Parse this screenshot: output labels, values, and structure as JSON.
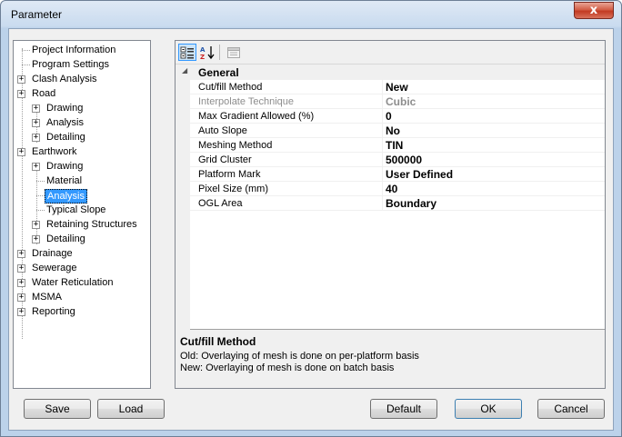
{
  "window": {
    "title": "Parameter",
    "close_label": "x"
  },
  "tree": {
    "items": [
      {
        "label": "Project Information",
        "level": 0,
        "expander": false
      },
      {
        "label": "Program Settings",
        "level": 0,
        "expander": false
      },
      {
        "label": "Clash Analysis",
        "level": 0,
        "expander": true
      },
      {
        "label": "Road",
        "level": 0,
        "expander": true
      },
      {
        "label": "Drawing",
        "level": 1,
        "expander": true
      },
      {
        "label": "Analysis",
        "level": 1,
        "expander": true
      },
      {
        "label": "Detailing",
        "level": 1,
        "expander": true
      },
      {
        "label": "Earthwork",
        "level": 0,
        "expander": true
      },
      {
        "label": "Drawing",
        "level": 1,
        "expander": true
      },
      {
        "label": "Material",
        "level": 1,
        "expander": false
      },
      {
        "label": "Analysis",
        "level": 1,
        "expander": false,
        "selected": true
      },
      {
        "label": "Typical Slope",
        "level": 1,
        "expander": false
      },
      {
        "label": "Retaining Structures",
        "level": 1,
        "expander": true
      },
      {
        "label": "Detailing",
        "level": 1,
        "expander": true
      },
      {
        "label": "Drainage",
        "level": 0,
        "expander": true
      },
      {
        "label": "Sewerage",
        "level": 0,
        "expander": true
      },
      {
        "label": "Water Reticulation",
        "level": 0,
        "expander": true
      },
      {
        "label": "MSMA",
        "level": 0,
        "expander": true
      },
      {
        "label": "Reporting",
        "level": 0,
        "expander": true
      }
    ],
    "expander_symbol": "+"
  },
  "propertygrid": {
    "toolbar": {
      "categorized_icon": "categorized-icon",
      "alphabetical_icon": "sort-alphabetical-icon",
      "property_pages_icon": "property-pages-icon"
    },
    "category": "General",
    "properties": [
      {
        "name": "Cut/fill Method",
        "value": "New",
        "disabled": false
      },
      {
        "name": "Interpolate Technique",
        "value": "Cubic",
        "disabled": true
      },
      {
        "name": "Max Gradient Allowed (%)",
        "value": "0",
        "disabled": false
      },
      {
        "name": "Auto Slope",
        "value": "No",
        "disabled": false
      },
      {
        "name": "Meshing Method",
        "value": "TIN",
        "disabled": false
      },
      {
        "name": "Grid Cluster",
        "value": "500000",
        "disabled": false
      },
      {
        "name": "Platform Mark",
        "value": "User Defined",
        "disabled": false
      },
      {
        "name": "Pixel Size (mm)",
        "value": "40",
        "disabled": false
      },
      {
        "name": "OGL Area",
        "value": "Boundary",
        "disabled": false
      }
    ],
    "description": {
      "title": "Cut/fill Method",
      "line1": "Old: Overlaying of mesh is done on per-platform basis",
      "line2": "New: Overlaying of mesh is done on batch basis"
    }
  },
  "buttons": {
    "save": "Save",
    "load": "Load",
    "default": "Default",
    "ok": "OK",
    "cancel": "Cancel"
  }
}
